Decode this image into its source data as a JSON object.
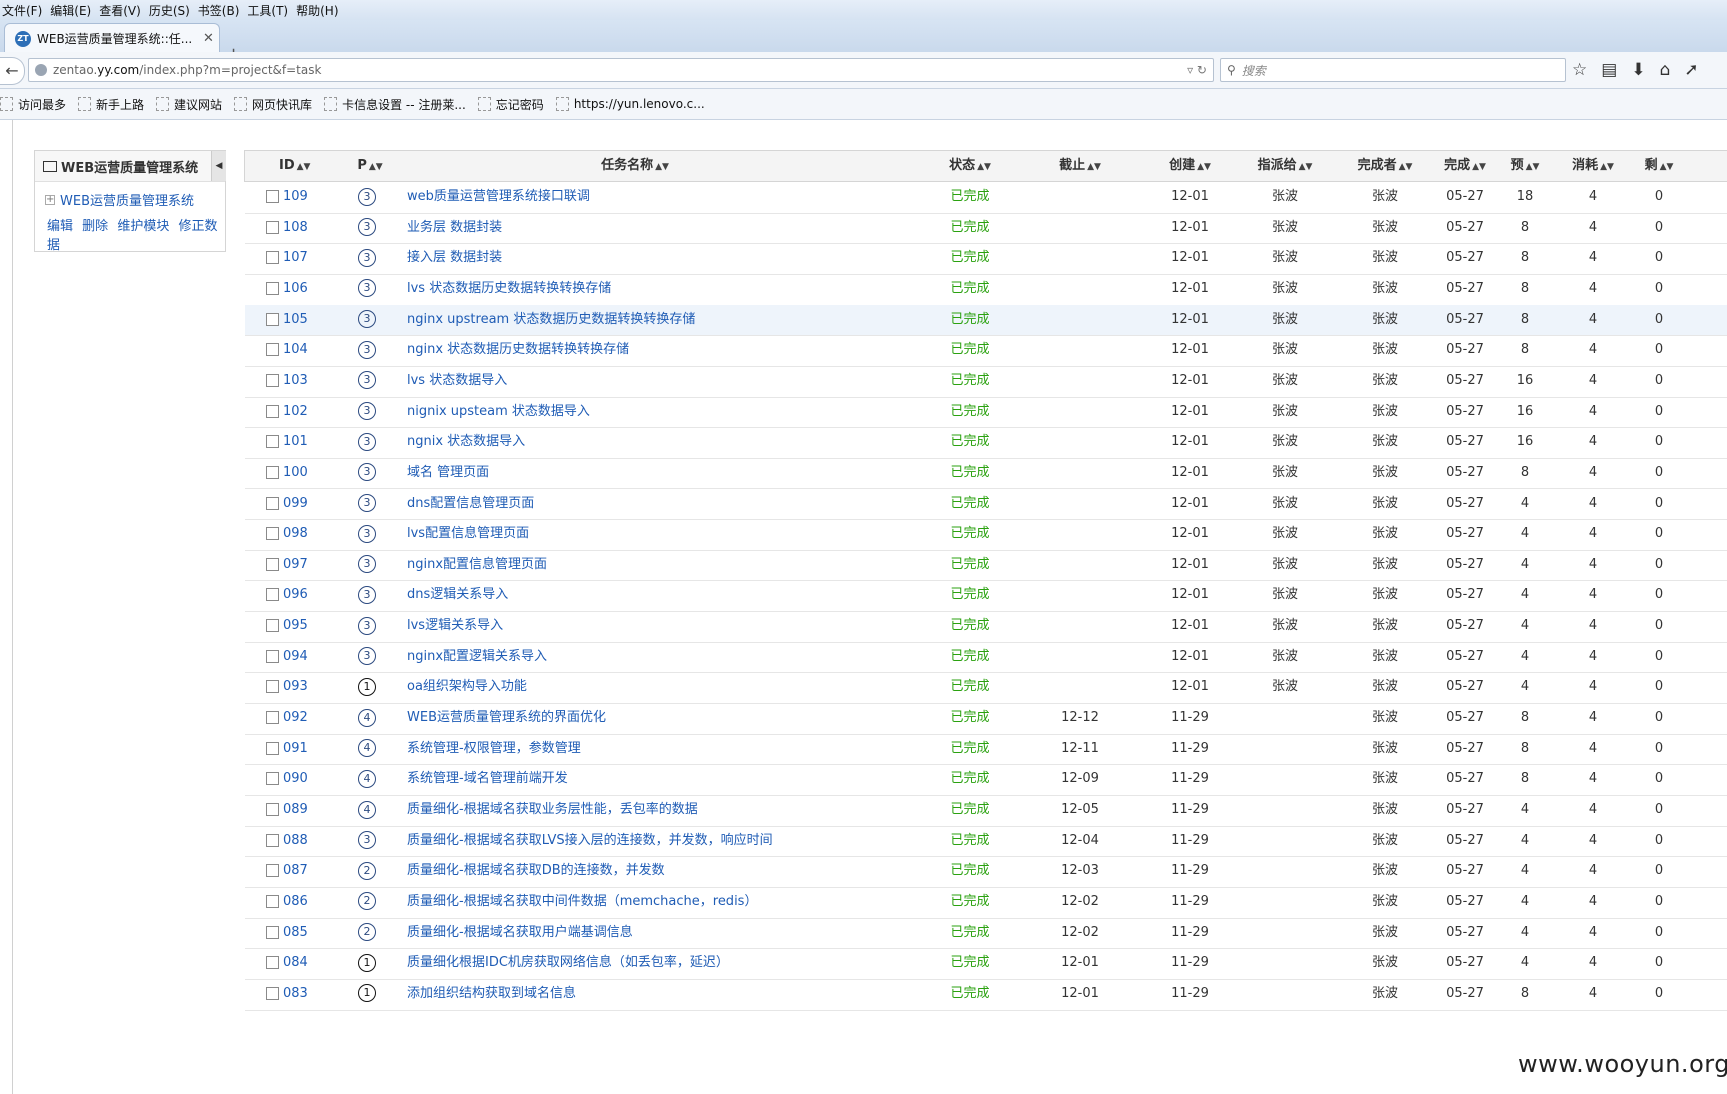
{
  "menu": [
    "文件(F)",
    "编辑(E)",
    "查看(V)",
    "历史(S)",
    "书签(B)",
    "工具(T)",
    "帮助(H)"
  ],
  "tab": {
    "favicon": "ZT",
    "title": "WEB运营质量管理系统::任..."
  },
  "url": {
    "prefix": "zentao.",
    "domain": "yy.com",
    "path": "/index.php?m=project&f=task"
  },
  "search": {
    "placeholder": "搜索"
  },
  "bookmarks": [
    "访问最多",
    "新手上路",
    "建议网站",
    "网页快讯库",
    "卡信息设置 -- 注册莱...",
    "忘记密码",
    "https://yun.lenovo.c..."
  ],
  "sidebar": {
    "title": "WEB运营质量管理系统",
    "node": "WEB运营质量管理系统",
    "actions": [
      "编辑",
      "删除",
      "维护模块",
      "修正数据"
    ]
  },
  "columns": {
    "id": "ID",
    "pri": "P",
    "name": "任务名称",
    "status": "状态",
    "deadline": "截止",
    "created": "创建",
    "assigned": "指派给",
    "finisher": "完成者",
    "finished": "完成",
    "estimate": "预",
    "consumed": "消耗",
    "left": "剩"
  },
  "tasks": [
    {
      "id": "109",
      "pri": "3",
      "name": "web质量运营管理系统接口联调",
      "status": "已完成",
      "deadline": "",
      "created": "12-01",
      "assigned": "张波",
      "finisher": "张波",
      "finished": "05-27",
      "estimate": "18",
      "consumed": "4",
      "left": "0"
    },
    {
      "id": "108",
      "pri": "3",
      "name": "业务层 数据封装",
      "status": "已完成",
      "deadline": "",
      "created": "12-01",
      "assigned": "张波",
      "finisher": "张波",
      "finished": "05-27",
      "estimate": "8",
      "consumed": "4",
      "left": "0"
    },
    {
      "id": "107",
      "pri": "3",
      "name": "接入层 数据封装",
      "status": "已完成",
      "deadline": "",
      "created": "12-01",
      "assigned": "张波",
      "finisher": "张波",
      "finished": "05-27",
      "estimate": "8",
      "consumed": "4",
      "left": "0"
    },
    {
      "id": "106",
      "pri": "3",
      "name": "lvs 状态数据历史数据转换转换存储",
      "status": "已完成",
      "deadline": "",
      "created": "12-01",
      "assigned": "张波",
      "finisher": "张波",
      "finished": "05-27",
      "estimate": "8",
      "consumed": "4",
      "left": "0"
    },
    {
      "id": "105",
      "pri": "3",
      "name": "nginx upstream 状态数据历史数据转换转换存储",
      "status": "已完成",
      "deadline": "",
      "created": "12-01",
      "assigned": "张波",
      "finisher": "张波",
      "finished": "05-27",
      "estimate": "8",
      "consumed": "4",
      "left": "0"
    },
    {
      "id": "104",
      "pri": "3",
      "name": "nginx 状态数据历史数据转换转换存储",
      "status": "已完成",
      "deadline": "",
      "created": "12-01",
      "assigned": "张波",
      "finisher": "张波",
      "finished": "05-27",
      "estimate": "8",
      "consumed": "4",
      "left": "0"
    },
    {
      "id": "103",
      "pri": "3",
      "name": "lvs 状态数据导入",
      "status": "已完成",
      "deadline": "",
      "created": "12-01",
      "assigned": "张波",
      "finisher": "张波",
      "finished": "05-27",
      "estimate": "16",
      "consumed": "4",
      "left": "0"
    },
    {
      "id": "102",
      "pri": "3",
      "name": "nignix upsteam 状态数据导入",
      "status": "已完成",
      "deadline": "",
      "created": "12-01",
      "assigned": "张波",
      "finisher": "张波",
      "finished": "05-27",
      "estimate": "16",
      "consumed": "4",
      "left": "0"
    },
    {
      "id": "101",
      "pri": "3",
      "name": "ngnix 状态数据导入",
      "status": "已完成",
      "deadline": "",
      "created": "12-01",
      "assigned": "张波",
      "finisher": "张波",
      "finished": "05-27",
      "estimate": "16",
      "consumed": "4",
      "left": "0"
    },
    {
      "id": "100",
      "pri": "3",
      "name": "域名 管理页面",
      "status": "已完成",
      "deadline": "",
      "created": "12-01",
      "assigned": "张波",
      "finisher": "张波",
      "finished": "05-27",
      "estimate": "8",
      "consumed": "4",
      "left": "0"
    },
    {
      "id": "099",
      "pri": "3",
      "name": "dns配置信息管理页面",
      "status": "已完成",
      "deadline": "",
      "created": "12-01",
      "assigned": "张波",
      "finisher": "张波",
      "finished": "05-27",
      "estimate": "4",
      "consumed": "4",
      "left": "0"
    },
    {
      "id": "098",
      "pri": "3",
      "name": "lvs配置信息管理页面",
      "status": "已完成",
      "deadline": "",
      "created": "12-01",
      "assigned": "张波",
      "finisher": "张波",
      "finished": "05-27",
      "estimate": "4",
      "consumed": "4",
      "left": "0"
    },
    {
      "id": "097",
      "pri": "3",
      "name": "nginx配置信息管理页面",
      "status": "已完成",
      "deadline": "",
      "created": "12-01",
      "assigned": "张波",
      "finisher": "张波",
      "finished": "05-27",
      "estimate": "4",
      "consumed": "4",
      "left": "0"
    },
    {
      "id": "096",
      "pri": "3",
      "name": "dns逻辑关系导入",
      "status": "已完成",
      "deadline": "",
      "created": "12-01",
      "assigned": "张波",
      "finisher": "张波",
      "finished": "05-27",
      "estimate": "4",
      "consumed": "4",
      "left": "0"
    },
    {
      "id": "095",
      "pri": "3",
      "name": "lvs逻辑关系导入",
      "status": "已完成",
      "deadline": "",
      "created": "12-01",
      "assigned": "张波",
      "finisher": "张波",
      "finished": "05-27",
      "estimate": "4",
      "consumed": "4",
      "left": "0"
    },
    {
      "id": "094",
      "pri": "3",
      "name": "nginx配置逻辑关系导入",
      "status": "已完成",
      "deadline": "",
      "created": "12-01",
      "assigned": "张波",
      "finisher": "张波",
      "finished": "05-27",
      "estimate": "4",
      "consumed": "4",
      "left": "0"
    },
    {
      "id": "093",
      "pri": "1",
      "name": "oa组织架构导入功能",
      "status": "已完成",
      "deadline": "",
      "created": "12-01",
      "assigned": "张波",
      "finisher": "张波",
      "finished": "05-27",
      "estimate": "4",
      "consumed": "4",
      "left": "0"
    },
    {
      "id": "092",
      "pri": "4",
      "name": "WEB运营质量管理系统的界面优化",
      "status": "已完成",
      "deadline": "12-12",
      "created": "11-29",
      "assigned": "",
      "finisher": "张波",
      "finished": "05-27",
      "estimate": "8",
      "consumed": "4",
      "left": "0"
    },
    {
      "id": "091",
      "pri": "4",
      "name": "系统管理-权限管理，参数管理",
      "status": "已完成",
      "deadline": "12-11",
      "created": "11-29",
      "assigned": "",
      "finisher": "张波",
      "finished": "05-27",
      "estimate": "8",
      "consumed": "4",
      "left": "0"
    },
    {
      "id": "090",
      "pri": "4",
      "name": "系统管理-域名管理前端开发",
      "status": "已完成",
      "deadline": "12-09",
      "created": "11-29",
      "assigned": "",
      "finisher": "张波",
      "finished": "05-27",
      "estimate": "8",
      "consumed": "4",
      "left": "0"
    },
    {
      "id": "089",
      "pri": "4",
      "name": "质量细化-根据域名获取业务层性能，丢包率的数据",
      "status": "已完成",
      "deadline": "12-05",
      "created": "11-29",
      "assigned": "",
      "finisher": "张波",
      "finished": "05-27",
      "estimate": "4",
      "consumed": "4",
      "left": "0"
    },
    {
      "id": "088",
      "pri": "3",
      "name": "质量细化-根据域名获取LVS接入层的连接数，并发数，响应时间",
      "status": "已完成",
      "deadline": "12-04",
      "created": "11-29",
      "assigned": "",
      "finisher": "张波",
      "finished": "05-27",
      "estimate": "4",
      "consumed": "4",
      "left": "0"
    },
    {
      "id": "087",
      "pri": "2",
      "name": "质量细化-根据域名获取DB的连接数，并发数",
      "status": "已完成",
      "deadline": "12-03",
      "created": "11-29",
      "assigned": "",
      "finisher": "张波",
      "finished": "05-27",
      "estimate": "4",
      "consumed": "4",
      "left": "0"
    },
    {
      "id": "086",
      "pri": "2",
      "name": "质量细化-根据域名获取中间件数据（memchache，redis）",
      "status": "已完成",
      "deadline": "12-02",
      "created": "11-29",
      "assigned": "",
      "finisher": "张波",
      "finished": "05-27",
      "estimate": "4",
      "consumed": "4",
      "left": "0"
    },
    {
      "id": "085",
      "pri": "2",
      "name": "质量细化-根据域名获取用户端基调信息",
      "status": "已完成",
      "deadline": "12-02",
      "created": "11-29",
      "assigned": "",
      "finisher": "张波",
      "finished": "05-27",
      "estimate": "4",
      "consumed": "4",
      "left": "0"
    },
    {
      "id": "084",
      "pri": "1",
      "name": "质量细化根据IDC机房获取网络信息（如丢包率，延迟）",
      "status": "已完成",
      "deadline": "12-01",
      "created": "11-29",
      "assigned": "",
      "finisher": "张波",
      "finished": "05-27",
      "estimate": "4",
      "consumed": "4",
      "left": "0"
    },
    {
      "id": "083",
      "pri": "1",
      "name": "添加组织结构获取到域名信息",
      "status": "已完成",
      "deadline": "12-01",
      "created": "11-29",
      "assigned": "",
      "finisher": "张波",
      "finished": "05-27",
      "estimate": "8",
      "consumed": "4",
      "left": "0"
    }
  ],
  "watermark": "www.wooyun.org",
  "colors": {
    "link": "#1f5cb5",
    "done": "#2aa10f"
  }
}
